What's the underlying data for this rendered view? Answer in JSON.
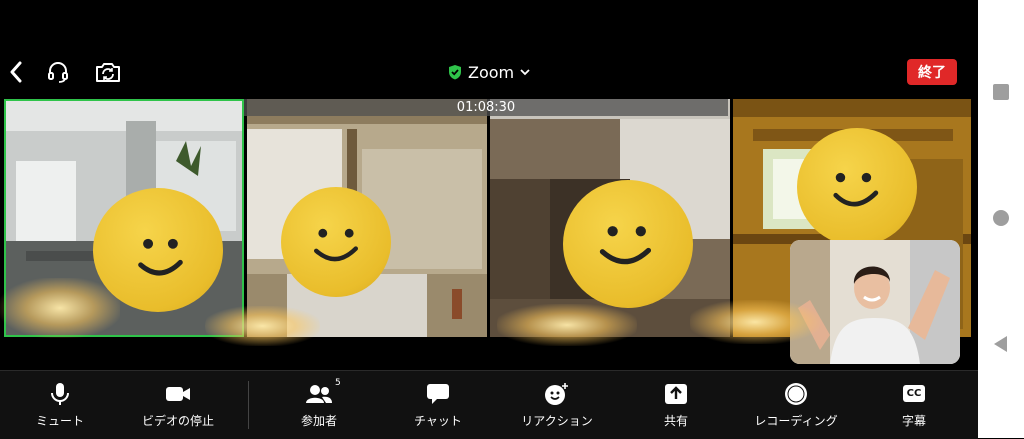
{
  "header": {
    "title": "Zoom",
    "end_label": "終了",
    "timer": "01:08:30"
  },
  "toolbar": {
    "items": [
      {
        "label": "ミュート",
        "icon": "microphone-icon"
      },
      {
        "label": "ビデオの停止",
        "icon": "video-camera-icon"
      },
      {
        "label": "参加者",
        "icon": "participants-icon",
        "badge": "5"
      },
      {
        "label": "チャット",
        "icon": "chat-icon"
      },
      {
        "label": "リアクション",
        "icon": "reaction-icon"
      },
      {
        "label": "共有",
        "icon": "share-icon"
      },
      {
        "label": "レコーディング",
        "icon": "record-icon"
      },
      {
        "label": "字幕",
        "icon": "captions-icon",
        "icon_text": "CC"
      }
    ]
  },
  "colors": {
    "end_button": "#e02828",
    "active_speaker_border": "#2fc34a",
    "secure_shield": "#2fc34a"
  }
}
